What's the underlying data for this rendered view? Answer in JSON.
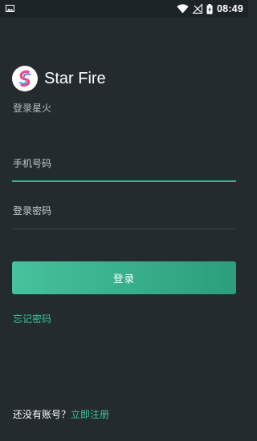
{
  "status_bar": {
    "time": "08:49",
    "icons": [
      "gallery-icon",
      "wifi-icon",
      "signal-icon",
      "battery-charging-icon"
    ]
  },
  "brand": {
    "app_name": "Star Fire",
    "subtitle": "登录星火",
    "logo_icon": "star-fire-logo-icon"
  },
  "form": {
    "phone_placeholder": "手机号码",
    "phone_value": "",
    "password_placeholder": "登录密码",
    "password_value": "",
    "login_label": "登录",
    "forgot_label": "忘记密码"
  },
  "footer": {
    "prompt": "还没有账号？",
    "register_label": "立即注册"
  },
  "colors": {
    "background": "#232b2f",
    "status_bar": "#1c2326",
    "accent": "#3fc296",
    "button_gradient_start": "#47c29a",
    "button_gradient_end": "#2b9e7a",
    "divider": "#3c4549"
  }
}
